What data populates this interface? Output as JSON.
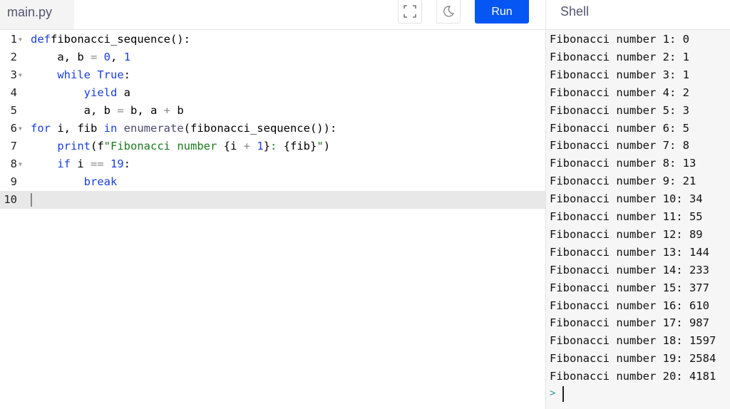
{
  "tab": {
    "filename": "main.py"
  },
  "toolbar": {
    "fullscreen_icon": "fullscreen-icon",
    "theme_icon": "moon-icon",
    "run_label": "Run",
    "run_color": "#0556f3"
  },
  "shell": {
    "title": "Shell",
    "prompt": ">",
    "output": [
      "Fibonacci number 1: 0",
      "Fibonacci number 2: 1",
      "Fibonacci number 3: 1",
      "Fibonacci number 4: 2",
      "Fibonacci number 5: 3",
      "Fibonacci number 6: 5",
      "Fibonacci number 7: 8",
      "Fibonacci number 8: 13",
      "Fibonacci number 9: 21",
      "Fibonacci number 10: 34",
      "Fibonacci number 11: 55",
      "Fibonacci number 12: 89",
      "Fibonacci number 13: 144",
      "Fibonacci number 14: 233",
      "Fibonacci number 15: 377",
      "Fibonacci number 16: 610",
      "Fibonacci number 17: 987",
      "Fibonacci number 18: 1597",
      "Fibonacci number 19: 2584",
      "Fibonacci number 20: 4181"
    ]
  },
  "editor": {
    "active_line": 10,
    "lines": [
      {
        "n": "1",
        "fold": true,
        "tokens": [
          [
            "kw",
            "def"
          ],
          [
            "",
            "fibonacci_sequence():"
          ]
        ]
      },
      {
        "n": "2",
        "fold": false,
        "tokens": [
          [
            "",
            "    a, b "
          ],
          [
            "op",
            "="
          ],
          [
            "",
            ""
          ],
          [
            "num",
            " 0"
          ],
          [
            "",
            ", "
          ],
          [
            "num",
            "1"
          ]
        ]
      },
      {
        "n": "3",
        "fold": true,
        "tokens": [
          [
            "",
            "    "
          ],
          [
            "kw",
            "while"
          ],
          [
            "bi",
            " True"
          ],
          [
            "",
            ":"
          ]
        ]
      },
      {
        "n": "4",
        "fold": false,
        "tokens": [
          [
            "",
            "        "
          ],
          [
            "kw",
            "yield"
          ],
          [
            "",
            " a"
          ]
        ]
      },
      {
        "n": "5",
        "fold": false,
        "tokens": [
          [
            "",
            "        a, b "
          ],
          [
            "op",
            "="
          ],
          [
            "",
            " b, a "
          ],
          [
            "op",
            "+"
          ],
          [
            "",
            " b"
          ]
        ]
      },
      {
        "n": "6",
        "fold": true,
        "tokens": [
          [
            "kw",
            "for"
          ],
          [
            "",
            " i, fib "
          ],
          [
            "kw",
            "in"
          ],
          [
            "fn",
            " enumerate"
          ],
          [
            "",
            "(fibonacci_sequence()):"
          ]
        ]
      },
      {
        "n": "7",
        "fold": false,
        "tokens": [
          [
            "",
            "    "
          ],
          [
            "bi",
            "print"
          ],
          [
            "",
            "(f"
          ],
          [
            "str",
            "\"Fibonacci number "
          ],
          [
            "",
            "{i "
          ],
          [
            "op",
            "+"
          ],
          [
            "num",
            " 1"
          ],
          [
            "",
            "}"
          ],
          [
            "str",
            ": "
          ],
          [
            "",
            "{fib}"
          ],
          [
            "str",
            "\""
          ],
          [
            "",
            ")"
          ]
        ]
      },
      {
        "n": "8",
        "fold": true,
        "tokens": [
          [
            "",
            "    "
          ],
          [
            "kw",
            "if"
          ],
          [
            "",
            " i "
          ],
          [
            "op",
            "=="
          ],
          [
            "num",
            " 19"
          ],
          [
            "",
            ":"
          ]
        ]
      },
      {
        "n": "9",
        "fold": false,
        "tokens": [
          [
            "",
            "        "
          ],
          [
            "kw",
            "break"
          ]
        ]
      },
      {
        "n": "10",
        "fold": false,
        "tokens": []
      }
    ]
  }
}
